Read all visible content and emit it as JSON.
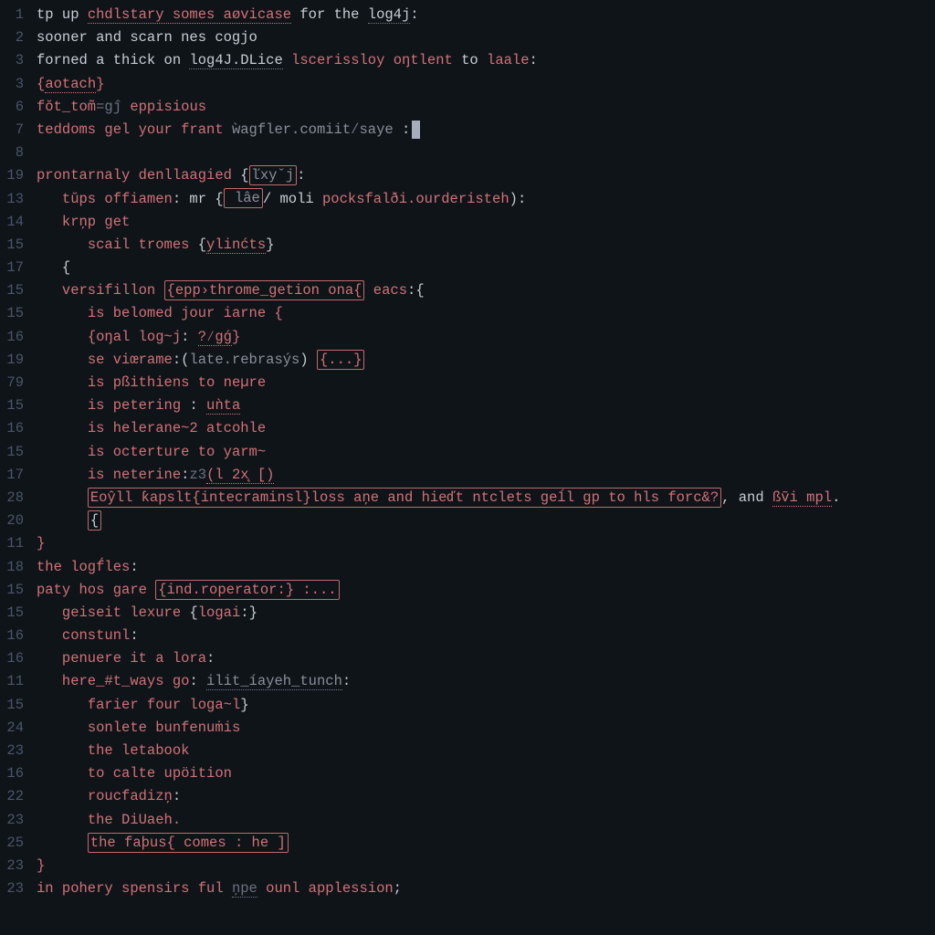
{
  "colors": {
    "background": "#0f1419",
    "gutter": "#4a5568",
    "plain": "#c8ccd4",
    "keyword": "#d17277",
    "dim": "#8a8f98",
    "gray": "#6b7280",
    "box_border": "#c06a6f"
  },
  "lines": [
    {
      "num": "1",
      "indent": 0,
      "spans": [
        {
          "t": "tp up ",
          "cls": "tok-plain"
        },
        {
          "t": "chdlstary somes aøvicase",
          "cls": "tok-red underline-red"
        },
        {
          "t": " for the ",
          "cls": "tok-plain"
        },
        {
          "t": "log4j",
          "cls": "tok-plain underline-gray"
        },
        {
          "t": ":",
          "cls": "tok-plain"
        }
      ]
    },
    {
      "num": "2",
      "indent": 0,
      "spans": [
        {
          "t": "sooner and scarn nes cogjo",
          "cls": "tok-plain"
        }
      ]
    },
    {
      "num": "3",
      "indent": 0,
      "spans": [
        {
          "t": "forned a thick on ",
          "cls": "tok-plain"
        },
        {
          "t": "log4J.DLice",
          "cls": "tok-plain underline-gray"
        },
        {
          "t": " ",
          "cls": "tok-plain"
        },
        {
          "t": "lscerissloy oŋtlent",
          "cls": "tok-red"
        },
        {
          "t": " to ",
          "cls": "tok-plain"
        },
        {
          "t": "laale",
          "cls": "tok-red"
        },
        {
          "t": ":",
          "cls": "tok-plain"
        }
      ]
    },
    {
      "num": "3",
      "indent": 0,
      "spans": [
        {
          "t": "{",
          "cls": "tok-red"
        },
        {
          "t": "aotach",
          "cls": "tok-red underline-red"
        },
        {
          "t": "}",
          "cls": "tok-red"
        }
      ]
    },
    {
      "num": "6",
      "indent": 0,
      "spans": [
        {
          "t": "fŏt_tom̃",
          "cls": "tok-red"
        },
        {
          "t": "=gĵ",
          "cls": "tok-gray"
        },
        {
          "t": " eppisious",
          "cls": "tok-red"
        }
      ]
    },
    {
      "num": "7",
      "indent": 0,
      "spans": [
        {
          "t": "teddoms gel your frant ",
          "cls": "tok-red"
        },
        {
          "t": "ẁagfler.comiit",
          "cls": "tok-dim"
        },
        {
          "t": "/",
          "cls": "tok-gray"
        },
        {
          "t": "saye",
          "cls": "tok-dim"
        },
        {
          "t": " ",
          "cls": "tok-plain"
        },
        {
          "t": ":",
          "cls": "tok-plain"
        },
        {
          "cursor": true
        }
      ]
    },
    {
      "num": "8",
      "indent": 0,
      "spans": []
    },
    {
      "num": "19",
      "indent": 0,
      "spans": [
        {
          "t": "prontarnaly denllaagied ",
          "cls": "tok-red"
        },
        {
          "t": "{",
          "cls": "tok-plain"
        },
        {
          "t": "ľxyˇj",
          "cls": "tok-dim box"
        },
        {
          "t": ":",
          "cls": "tok-plain"
        }
      ]
    },
    {
      "num": "13",
      "indent": 1,
      "spans": [
        {
          "t": "tŭps offiamen",
          "cls": "tok-red"
        },
        {
          "t": ": mr ",
          "cls": "tok-plain"
        },
        {
          "t": "{",
          "cls": "tok-plain"
        },
        {
          "t": " lâe",
          "cls": "tok-dim box"
        },
        {
          "t": "/ moli ",
          "cls": "tok-plain"
        },
        {
          "t": "pocksfalði.ourderisteh",
          "cls": "tok-red"
        },
        {
          "t": "):",
          "cls": "tok-plain"
        }
      ]
    },
    {
      "num": "14",
      "indent": 1,
      "spans": [
        {
          "t": "krņp get",
          "cls": "tok-red"
        }
      ]
    },
    {
      "num": "15",
      "indent": 2,
      "spans": [
        {
          "t": "scail tromes ",
          "cls": "tok-red"
        },
        {
          "t": "{",
          "cls": "tok-plain"
        },
        {
          "t": "ylinćts",
          "cls": "tok-red underline-red"
        },
        {
          "t": "}",
          "cls": "tok-plain"
        }
      ]
    },
    {
      "num": "17",
      "indent": 1,
      "spans": [
        {
          "t": "{",
          "cls": "tok-plain"
        }
      ]
    },
    {
      "num": "15",
      "indent": 1,
      "spans": [
        {
          "t": "versifillon",
          "cls": "tok-red"
        },
        {
          "t": " ",
          "cls": "tok-plain"
        },
        {
          "t": "{epp›throme_getion ona{",
          "cls": "tok-red box"
        },
        {
          "t": " ",
          "cls": "tok-plain"
        },
        {
          "t": "eacs",
          "cls": "tok-red"
        },
        {
          "t": ":{",
          "cls": "tok-plain"
        }
      ]
    },
    {
      "num": "15",
      "indent": 2,
      "spans": [
        {
          "t": "is belomed jour iarne {",
          "cls": "tok-red"
        }
      ]
    },
    {
      "num": "16",
      "indent": 2,
      "spans": [
        {
          "t": "{",
          "cls": "tok-red"
        },
        {
          "t": "oŋal log~j",
          "cls": "tok-red"
        },
        {
          "t": ": ",
          "cls": "tok-plain"
        },
        {
          "t": "?⁄gǵ",
          "cls": "tok-red underline-red"
        },
        {
          "t": "}",
          "cls": "tok-red"
        }
      ]
    },
    {
      "num": "19",
      "indent": 2,
      "spans": [
        {
          "t": "se viœrame",
          "cls": "tok-red"
        },
        {
          "t": ":(",
          "cls": "tok-plain"
        },
        {
          "t": "late.rebrasýs",
          "cls": "tok-dim"
        },
        {
          "t": ") ",
          "cls": "tok-plain"
        },
        {
          "t": "{...}",
          "cls": "tok-red box"
        }
      ]
    },
    {
      "num": "79",
      "indent": 2,
      "spans": [
        {
          "t": "is pßithiens to neµre",
          "cls": "tok-red"
        }
      ]
    },
    {
      "num": "15",
      "indent": 2,
      "spans": [
        {
          "t": "is petering ",
          "cls": "tok-red"
        },
        {
          "t": ": ",
          "cls": "tok-plain"
        },
        {
          "t": "uǹta",
          "cls": "tok-red underline-red"
        }
      ]
    },
    {
      "num": "16",
      "indent": 2,
      "spans": [
        {
          "t": "is helerane~2 atcohle",
          "cls": "tok-red"
        }
      ]
    },
    {
      "num": "15",
      "indent": 2,
      "spans": [
        {
          "t": "is octerture to yarm~",
          "cls": "tok-red"
        }
      ]
    },
    {
      "num": "17",
      "indent": 2,
      "spans": [
        {
          "t": "is neterine",
          "cls": "tok-red"
        },
        {
          "t": ":",
          "cls": "tok-plain"
        },
        {
          "t": "z3",
          "cls": "tok-gray"
        },
        {
          "t": "(l 2x̨ [)",
          "cls": "tok-red underline-red"
        }
      ]
    },
    {
      "num": "28",
      "indent": 2,
      "spans": [
        {
          "t": "Eoŷll ƙapslt{intecraminsl}loss aņe and hieďt ntclets geĺl gp to hls forc&?",
          "cls": "tok-red box"
        },
        {
          "t": ", and ",
          "cls": "tok-plain"
        },
        {
          "t": "ßṽi mpl",
          "cls": "tok-red underline-red"
        },
        {
          "t": ".",
          "cls": "tok-plain"
        }
      ]
    },
    {
      "num": "20",
      "indent": 2,
      "spans": [
        {
          "t": "{",
          "cls": "tok-plain box"
        }
      ]
    },
    {
      "num": "11",
      "indent": 0,
      "spans": [
        {
          "t": "}",
          "cls": "tok-red"
        }
      ]
    },
    {
      "num": "18",
      "indent": 0,
      "spans": [
        {
          "t": "the logf́les",
          "cls": "tok-red"
        },
        {
          "t": ":",
          "cls": "tok-plain"
        }
      ]
    },
    {
      "num": "15",
      "indent": 0,
      "spans": [
        {
          "t": "paty hos gare ",
          "cls": "tok-red"
        },
        {
          "t": "{ind.roperator:} :...",
          "cls": "tok-red box"
        }
      ]
    },
    {
      "num": "15",
      "indent": 1,
      "spans": [
        {
          "t": "geiseit lexure ",
          "cls": "tok-red"
        },
        {
          "t": "{",
          "cls": "tok-plain"
        },
        {
          "t": "logai",
          "cls": "tok-red"
        },
        {
          "t": ":",
          "cls": "tok-plain"
        },
        {
          "t": "}",
          "cls": "tok-plain"
        }
      ]
    },
    {
      "num": "16",
      "indent": 1,
      "spans": [
        {
          "t": "constunl",
          "cls": "tok-red"
        },
        {
          "t": ":",
          "cls": "tok-plain"
        }
      ]
    },
    {
      "num": "16",
      "indent": 1,
      "spans": [
        {
          "t": "penuere it a lora",
          "cls": "tok-red"
        },
        {
          "t": ":",
          "cls": "tok-plain"
        }
      ]
    },
    {
      "num": "11",
      "indent": 1,
      "spans": [
        {
          "t": "here_#t_ways go",
          "cls": "tok-red"
        },
        {
          "t": ": ",
          "cls": "tok-plain"
        },
        {
          "t": "ilit_íayeh_tunch",
          "cls": "tok-dim underline-gray"
        },
        {
          "t": ":",
          "cls": "tok-plain"
        }
      ]
    },
    {
      "num": "15",
      "indent": 2,
      "spans": [
        {
          "t": "farier four loga~l",
          "cls": "tok-red"
        },
        {
          "t": "}",
          "cls": "tok-plain"
        }
      ]
    },
    {
      "num": "24",
      "indent": 2,
      "spans": [
        {
          "t": "sonlete bunfenuṁis",
          "cls": "tok-red"
        }
      ]
    },
    {
      "num": "23",
      "indent": 2,
      "spans": [
        {
          "t": "the letabook",
          "cls": "tok-red"
        }
      ]
    },
    {
      "num": "16",
      "indent": 2,
      "spans": [
        {
          "t": "to calte upöition",
          "cls": "tok-red"
        }
      ]
    },
    {
      "num": "22",
      "indent": 2,
      "spans": [
        {
          "t": "roucfadizņ",
          "cls": "tok-red"
        },
        {
          "t": ":",
          "cls": "tok-plain"
        }
      ]
    },
    {
      "num": "23",
      "indent": 2,
      "spans": [
        {
          "t": "the DiUaeh.",
          "cls": "tok-red"
        }
      ]
    },
    {
      "num": "25",
      "indent": 2,
      "spans": [
        {
          "t": "the faþus{ comes : he ]",
          "cls": "tok-red box"
        }
      ]
    },
    {
      "num": "23",
      "indent": 0,
      "spans": [
        {
          "t": "}",
          "cls": "tok-red"
        }
      ]
    },
    {
      "num": "23",
      "indent": 0,
      "spans": [
        {
          "t": "in pohery spensirs ful ",
          "cls": "tok-red"
        },
        {
          "t": "ņpe",
          "cls": "tok-gray underline-gray"
        },
        {
          "t": " ounl applession",
          "cls": "tok-red"
        },
        {
          "t": ";",
          "cls": "tok-plain"
        }
      ]
    }
  ]
}
